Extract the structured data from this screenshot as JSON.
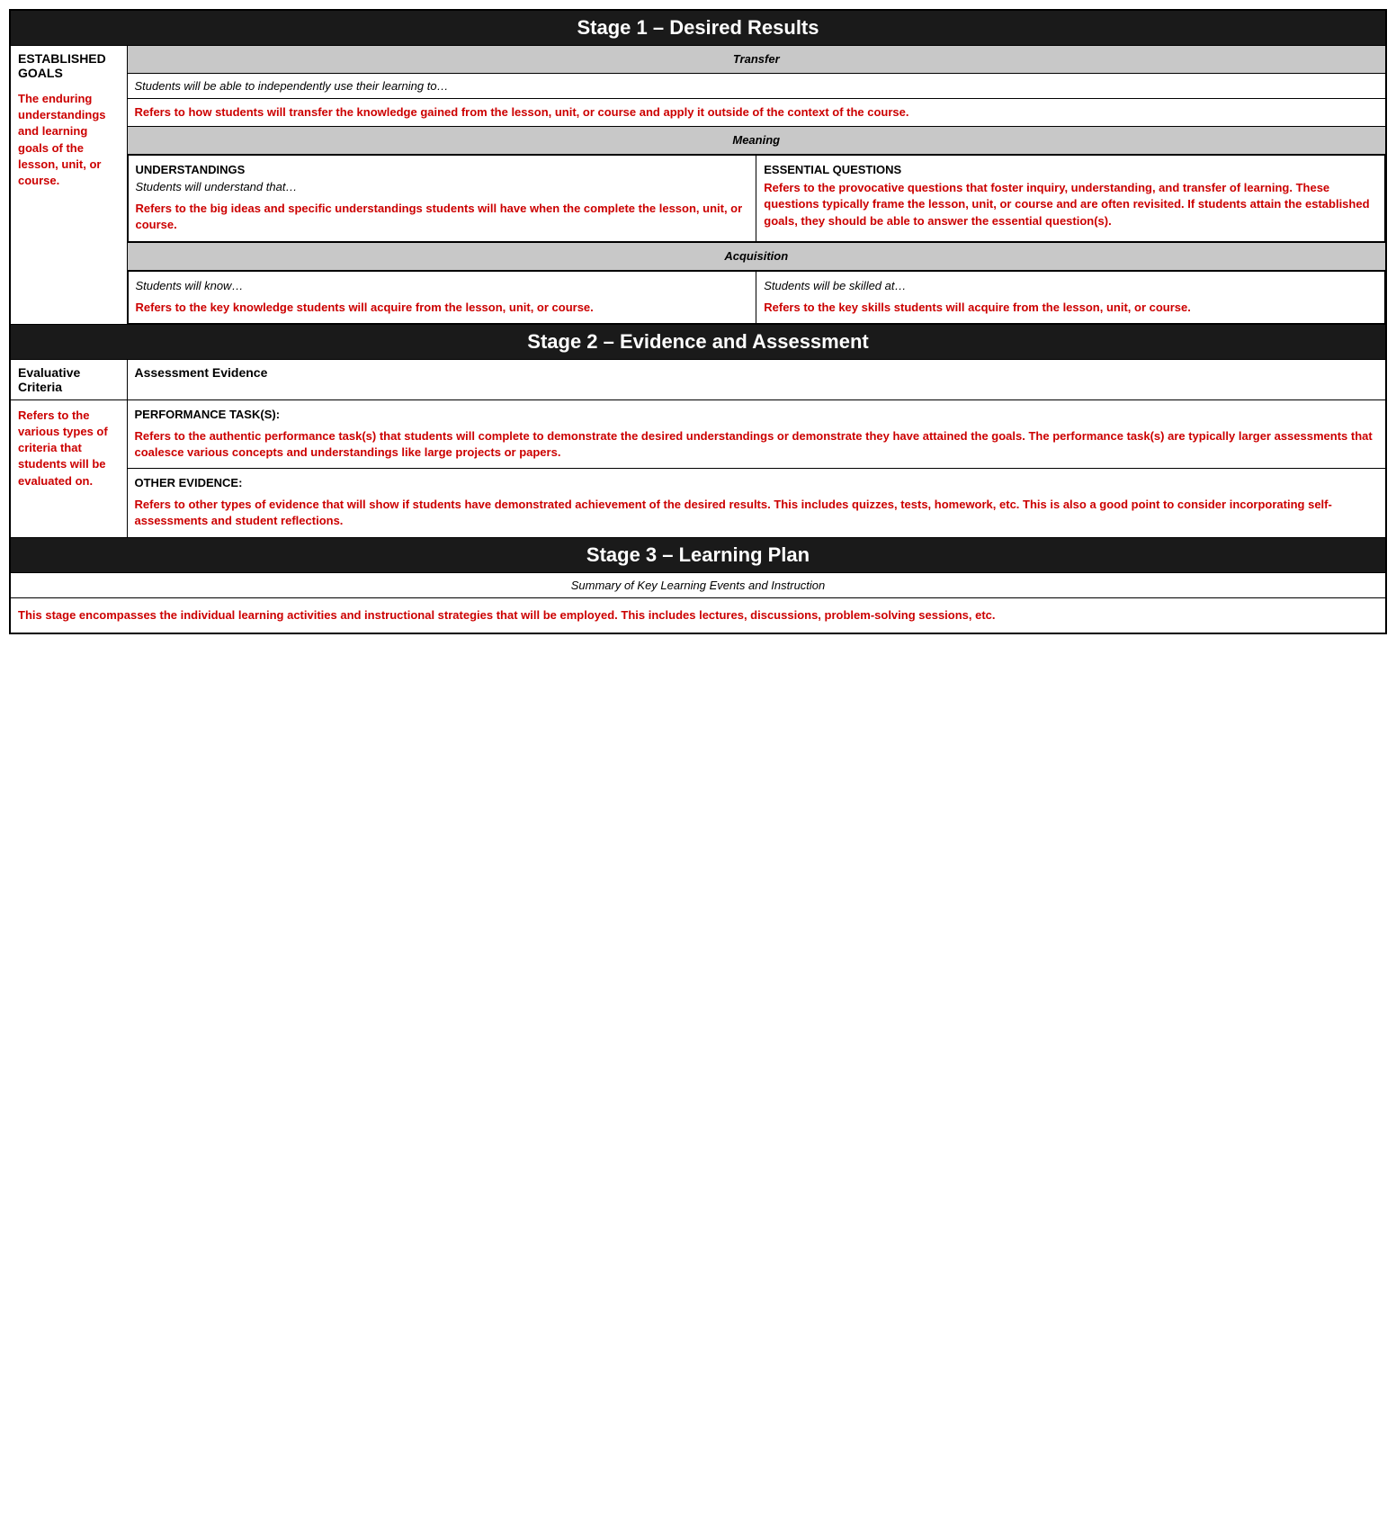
{
  "stage1": {
    "header": "Stage 1 – Desired Results",
    "established_goals_label": "ESTABLISHED GOALS",
    "established_goals_red": "The enduring understandings and learning goals of the lesson, unit, or course.",
    "transfer_label": "Transfer",
    "transfer_italic": "Students will be able to independently use their learning to…",
    "transfer_red": "Refers to how students will transfer the knowledge gained from the lesson, unit, or course and apply it outside of the context of the course.",
    "meaning_label": "Meaning",
    "understandings_label": "UNDERSTANDINGS",
    "understandings_italic": "Students will understand that…",
    "understandings_red": "Refers to the big ideas and specific understandings students will have when the complete the lesson, unit, or course.",
    "essential_questions_label": "ESSENTIAL QUESTIONS",
    "essential_questions_red": "Refers to the provocative questions that foster inquiry, understanding, and transfer of learning. These questions typically frame the lesson, unit, or course and are often revisited. If students attain the established goals, they should be able to answer the essential question(s).",
    "acquisition_label": "Acquisition",
    "know_italic": "Students will know…",
    "know_red": "Refers to the key knowledge students will acquire from the lesson, unit, or course.",
    "skilled_italic": "Students will be skilled at…",
    "skilled_red": "Refers to the key skills students will acquire from the lesson, unit, or course."
  },
  "stage2": {
    "header": "Stage 2 – Evidence and Assessment",
    "evaluative_criteria_label": "Evaluative Criteria",
    "assessment_evidence_label": "Assessment Evidence",
    "evaluative_red": "Refers to the various types of criteria that students will be evaluated on.",
    "performance_task_label": "PERFORMANCE TASK(S):",
    "performance_task_red": "Refers to the authentic performance task(s) that students will complete to demonstrate the desired understandings or demonstrate they have attained the goals. The performance task(s) are typically larger assessments that coalesce various concepts and understandings like large projects or papers.",
    "other_evidence_label": "OTHER EVIDENCE:",
    "other_evidence_red": "Refers to other types of evidence that will show if students have demonstrated achievement of the desired results. This includes quizzes, tests, homework, etc. This is also a good point to consider incorporating self-assessments and student reflections."
  },
  "stage3": {
    "header": "Stage 3 – Learning Plan",
    "summary_italic": "Summary of Key Learning Events and Instruction",
    "summary_red": "This stage encompasses the individual learning activities and instructional strategies that will be employed. This includes lectures, discussions, problem-solving sessions, etc."
  }
}
